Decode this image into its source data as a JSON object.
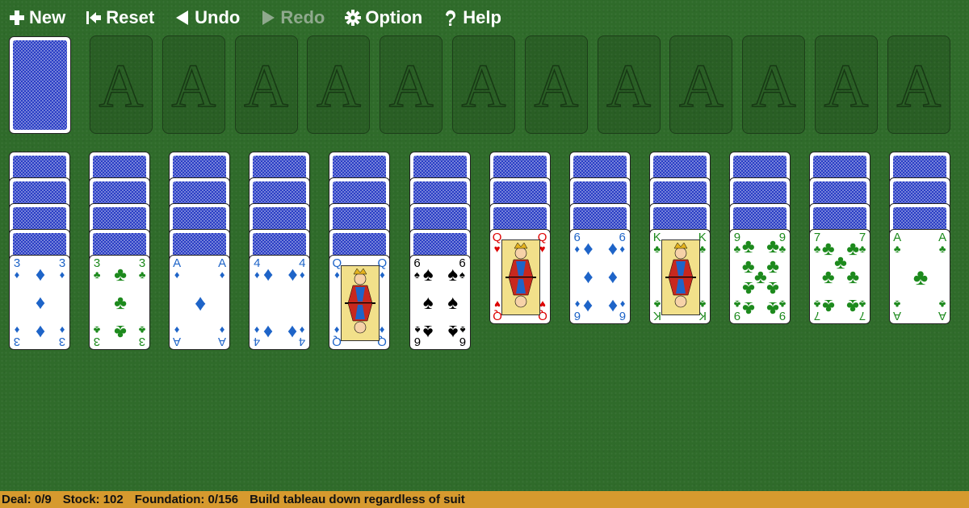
{
  "toolbar": {
    "new": {
      "label": "New",
      "icon": "plus-icon"
    },
    "reset": {
      "label": "Reset",
      "icon": "reset-icon"
    },
    "undo": {
      "label": "Undo",
      "icon": "undo-icon"
    },
    "redo": {
      "label": "Redo",
      "icon": "redo-icon",
      "disabled": true
    },
    "option": {
      "label": "Option",
      "icon": "gear-icon"
    },
    "help": {
      "label": "Help",
      "icon": "question-icon"
    }
  },
  "foundation_label": "A",
  "foundation_slots": 12,
  "tableau": [
    {
      "hidden": 4,
      "rank": "3",
      "suit": "diamond"
    },
    {
      "hidden": 4,
      "rank": "3",
      "suit": "club"
    },
    {
      "hidden": 4,
      "rank": "A",
      "suit": "diamond"
    },
    {
      "hidden": 4,
      "rank": "4",
      "suit": "diamond"
    },
    {
      "hidden": 4,
      "rank": "Q",
      "suit": "diamond"
    },
    {
      "hidden": 4,
      "rank": "6",
      "suit": "spade"
    },
    {
      "hidden": 3,
      "rank": "Q",
      "suit": "heart"
    },
    {
      "hidden": 3,
      "rank": "6",
      "suit": "diamond"
    },
    {
      "hidden": 3,
      "rank": "K",
      "suit": "club"
    },
    {
      "hidden": 3,
      "rank": "9",
      "suit": "club"
    },
    {
      "hidden": 3,
      "rank": "7",
      "suit": "club"
    },
    {
      "hidden": 3,
      "rank": "A",
      "suit": "club"
    }
  ],
  "status": {
    "deal": "Deal: 0/9",
    "stock": "Stock: 102",
    "foundation": "Foundation: 0/156",
    "rule": "Build tableau down regardless of suit"
  },
  "colors": {
    "felt": "#2f6b2a",
    "status_bar": "#d69a2e",
    "card_back": "#2a3ec5",
    "diamond": "#1e64c8",
    "club": "#1d8a1d",
    "heart": "#dd0000",
    "spade": "#000000"
  }
}
